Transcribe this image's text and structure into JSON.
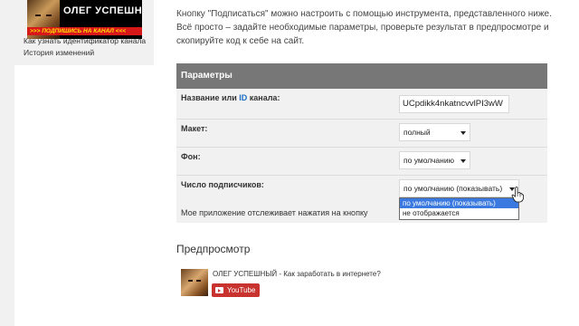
{
  "banner": {
    "title": "ОЛЕГ УСПЕШНЫЙ",
    "subtitle": ">>> ПОДПИШИСЬ НА КАНАЛ <<<"
  },
  "sidebar": {
    "items": [
      {
        "label": "Как узнать идентификатор канала"
      },
      {
        "label": "История изменений"
      }
    ]
  },
  "description": "Кнопку \"Подписаться\" можно настроить с помощью инструмента, представленного ниже. Всё просто – задайте необходимые параметры, проверьте результат в предпросмотре и скопируйте код к себе на сайт.",
  "params": {
    "header": "Параметры",
    "channel": {
      "label_pre": "Название или ",
      "label_id": "ID",
      "label_post": " канала:",
      "value": "UCpdikk4nkatncvvlPI3wW"
    },
    "layout": {
      "label": "Макет:",
      "value": "полный"
    },
    "theme": {
      "label": "Фон:",
      "value": "по умолчанию"
    },
    "count": {
      "label": "Число подписчиков:",
      "value": "по умолчанию (показывать)",
      "options": [
        "по умолчанию (показывать)",
        "не отображается"
      ]
    },
    "tracking": {
      "label": "Мое приложение отслеживает нажатия на кнопку"
    }
  },
  "preview": {
    "title": "Предпросмотр",
    "channel_name": "ОЛЕГ УСПЕШНЫЙ - Как заработать в интернете?",
    "button_label": "YouTube"
  },
  "colors": {
    "header_bg": "#777777",
    "table_bg": "#f1f1f1",
    "selected_option": "#3a7ae0",
    "youtube_red": "#c8332f",
    "id_accent": "#1b6ec2"
  },
  "icons": {
    "dropdown": "chevron-down-icon",
    "cursor": "hand-cursor-icon",
    "youtube": "youtube-play-icon"
  }
}
